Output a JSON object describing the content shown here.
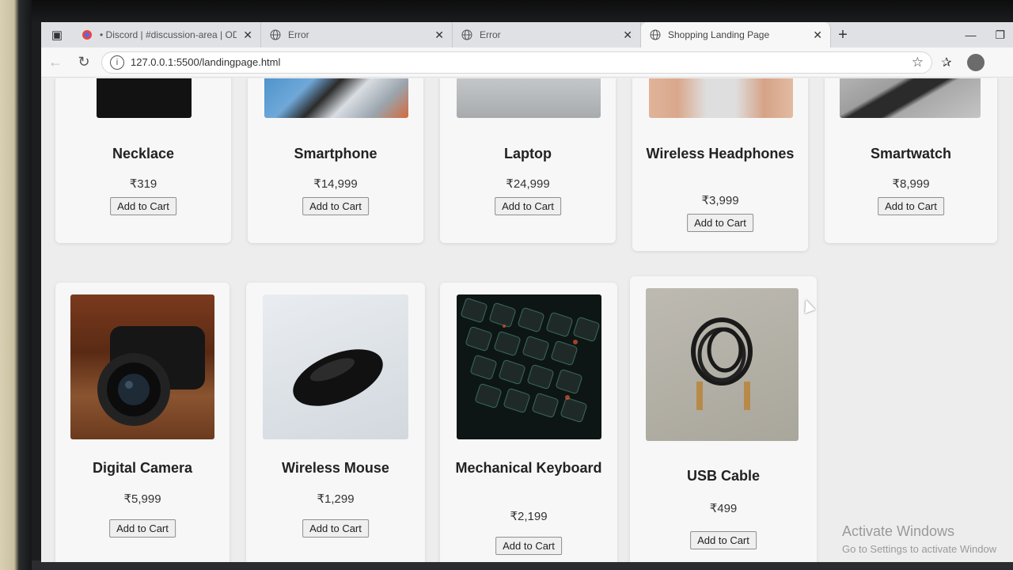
{
  "browser": {
    "tabs": [
      {
        "label": "• Discord | #discussion-area | OD(",
        "icon": "discord-icon",
        "active": false
      },
      {
        "label": "Error",
        "icon": "globe-icon",
        "active": false
      },
      {
        "label": "Error",
        "icon": "globe-icon",
        "active": false
      },
      {
        "label": "Shopping Landing Page",
        "icon": "globe-icon",
        "active": true
      }
    ],
    "url": "127.0.0.1:5500/landingpage.html"
  },
  "products": [
    {
      "name": "Necklace",
      "price": "₹319",
      "button": "Add to Cart"
    },
    {
      "name": "Smartphone",
      "price": "₹14,999",
      "button": "Add to Cart"
    },
    {
      "name": "Laptop",
      "price": "₹24,999",
      "button": "Add to Cart"
    },
    {
      "name": "Wireless Headphones",
      "price": "₹3,999",
      "button": "Add to Cart"
    },
    {
      "name": "Smartwatch",
      "price": "₹8,999",
      "button": "Add to Cart"
    },
    {
      "name": "Digital Camera",
      "price": "₹5,999",
      "button": "Add to Cart"
    },
    {
      "name": "Wireless Mouse",
      "price": "₹1,299",
      "button": "Add to Cart"
    },
    {
      "name": "Mechanical Keyboard",
      "price": "₹2,199",
      "button": "Add to Cart"
    },
    {
      "name": "USB Cable",
      "price": "₹499",
      "button": "Add to Cart"
    }
  ],
  "watermark": {
    "title": "Activate Windows",
    "subtitle": "Go to Settings to activate Window"
  }
}
